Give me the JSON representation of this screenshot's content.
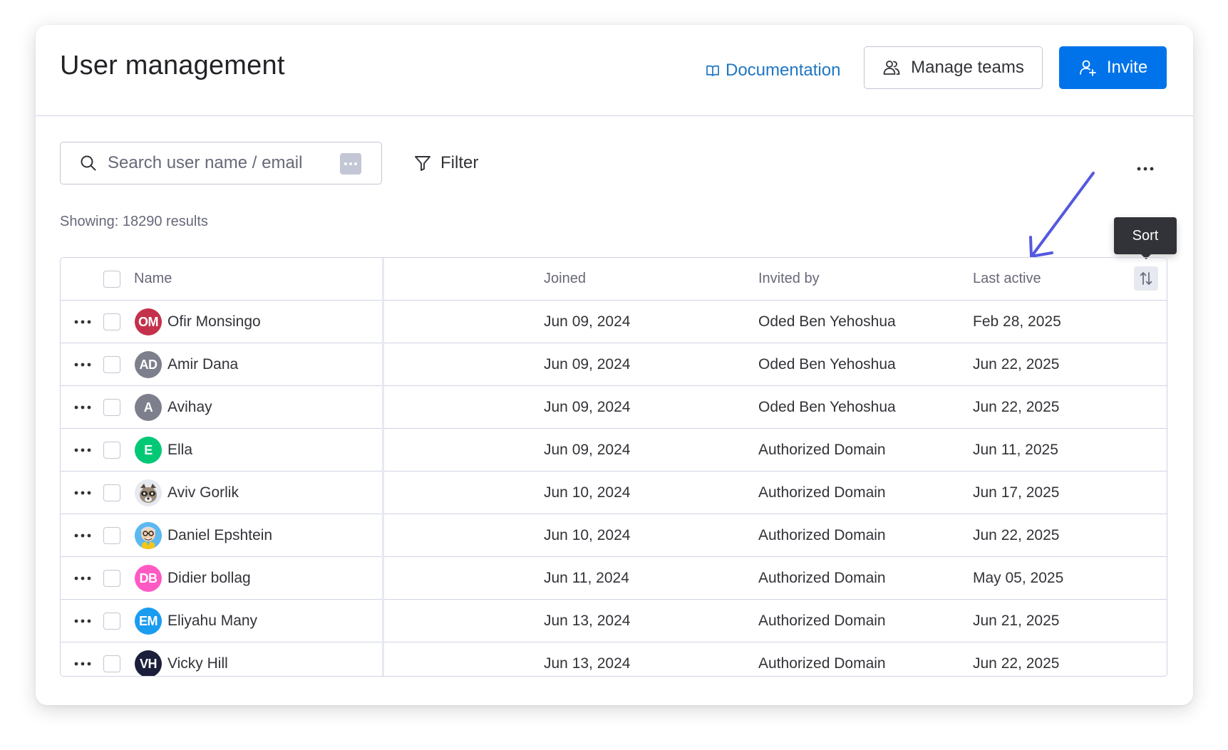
{
  "header": {
    "title": "User management",
    "documentation_label": "Documentation",
    "manage_teams_label": "Manage teams",
    "invite_label": "Invite"
  },
  "toolbar": {
    "search_placeholder": "Search user name / email",
    "filter_label": "Filter",
    "results_text": "Showing: 18290 results"
  },
  "tooltip": {
    "sort_label": "Sort"
  },
  "table": {
    "columns": {
      "name": "Name",
      "joined": "Joined",
      "invited_by": "Invited by",
      "last_active": "Last active"
    },
    "rows": [
      {
        "initials": "OM",
        "avatar_color": "#c4314b",
        "name": "Ofir Monsingo",
        "joined": "Jun 09, 2024",
        "invited_by": "Oded Ben Yehoshua",
        "last_active": "Feb 28, 2025"
      },
      {
        "initials": "AD",
        "avatar_color": "#7e7f8c",
        "name": "Amir Dana",
        "joined": "Jun 09, 2024",
        "invited_by": "Oded Ben Yehoshua",
        "last_active": "Jun 22, 2025"
      },
      {
        "initials": "A",
        "avatar_color": "#7e7f8c",
        "name": "Avihay",
        "joined": "Jun 09, 2024",
        "invited_by": "Oded Ben Yehoshua",
        "last_active": "Jun 22, 2025"
      },
      {
        "initials": "E",
        "avatar_color": "#00c875",
        "name": "Ella",
        "joined": "Jun 09, 2024",
        "invited_by": "Authorized Domain",
        "last_active": "Jun 11, 2025"
      },
      {
        "initials": "",
        "avatar_color": "#e6e9ef",
        "avatar_icon": "raccoon-avatar-image",
        "name": "Aviv Gorlik",
        "joined": "Jun 10, 2024",
        "invited_by": "Authorized Domain",
        "last_active": "Jun 17, 2025"
      },
      {
        "initials": "",
        "avatar_color": "#5cb8f0",
        "avatar_icon": "cartoon-avatar-image",
        "name": "Daniel Epshtein",
        "joined": "Jun 10, 2024",
        "invited_by": "Authorized Domain",
        "last_active": "Jun 22, 2025"
      },
      {
        "initials": "DB",
        "avatar_color": "#ff5ac4",
        "name": "Didier bollag",
        "joined": "Jun 11, 2024",
        "invited_by": "Authorized Domain",
        "last_active": "May 05, 2025"
      },
      {
        "initials": "EM",
        "avatar_color": "#1a9cf0",
        "name": "Eliyahu Many",
        "joined": "Jun 13, 2024",
        "invited_by": "Authorized Domain",
        "last_active": "Jun 21, 2025"
      },
      {
        "initials": "VH",
        "avatar_color": "#1c1f3b",
        "name": "Vicky Hill",
        "joined": "Jun 13, 2024",
        "invited_by": "Authorized Domain",
        "last_active": "Jun 22, 2025"
      }
    ]
  },
  "colors": {
    "primary": "#0073ea",
    "link": "#1f76c2",
    "annotation_arrow": "#5559df"
  }
}
